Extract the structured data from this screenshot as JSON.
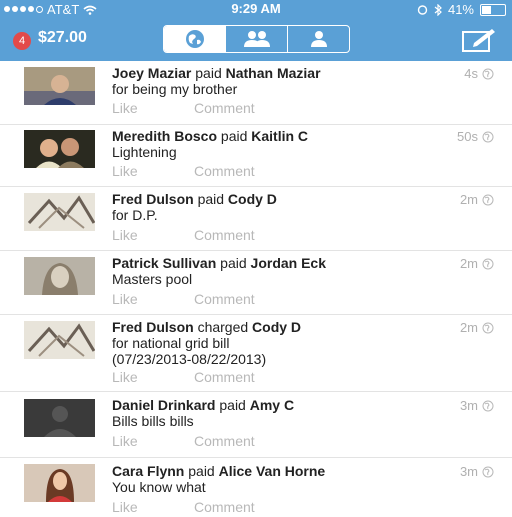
{
  "status": {
    "carrier": "AT&T",
    "time": "9:29 AM",
    "battery": "41%",
    "battery_level": 0.41
  },
  "header": {
    "badge": "4",
    "balance": "$27.00",
    "tabs": [
      "globe-icon",
      "friends-icon",
      "person-icon"
    ],
    "active_tab": 0
  },
  "feed": [
    {
      "actor": "Joey Maziar",
      "verb": "paid",
      "target": "Nathan Maziar",
      "note": "for being my brother",
      "time": "4s",
      "like": "Like",
      "comment": "Comment"
    },
    {
      "actor": "Meredith Bosco",
      "verb": "paid",
      "target": "Kaitlin C",
      "note": "Lightening",
      "time": "50s",
      "like": "Like",
      "comment": "Comment"
    },
    {
      "actor": "Fred Dulson",
      "verb": "paid",
      "target": "Cody D",
      "note": "for D.P.",
      "time": "2m",
      "like": "Like",
      "comment": "Comment"
    },
    {
      "actor": "Patrick Sullivan",
      "verb": "paid",
      "target": "Jordan Eck",
      "note": "Masters pool",
      "time": "2m",
      "like": "Like",
      "comment": "Comment"
    },
    {
      "actor": "Fred Dulson",
      "verb": "charged",
      "target": "Cody D",
      "note": "for national grid bill",
      "note2": "(07/23/2013-08/22/2013)",
      "time": "2m",
      "like": "Like",
      "comment": "Comment"
    },
    {
      "actor": "Daniel Drinkard",
      "verb": "paid",
      "target": "Amy C",
      "note": "Bills bills bills",
      "time": "3m",
      "like": "Like",
      "comment": "Comment"
    },
    {
      "actor": "Cara Flynn",
      "verb": "paid",
      "target": "Alice Van Horne",
      "note": "You know what",
      "time": "3m",
      "like": "Like",
      "comment": "Comment"
    }
  ]
}
